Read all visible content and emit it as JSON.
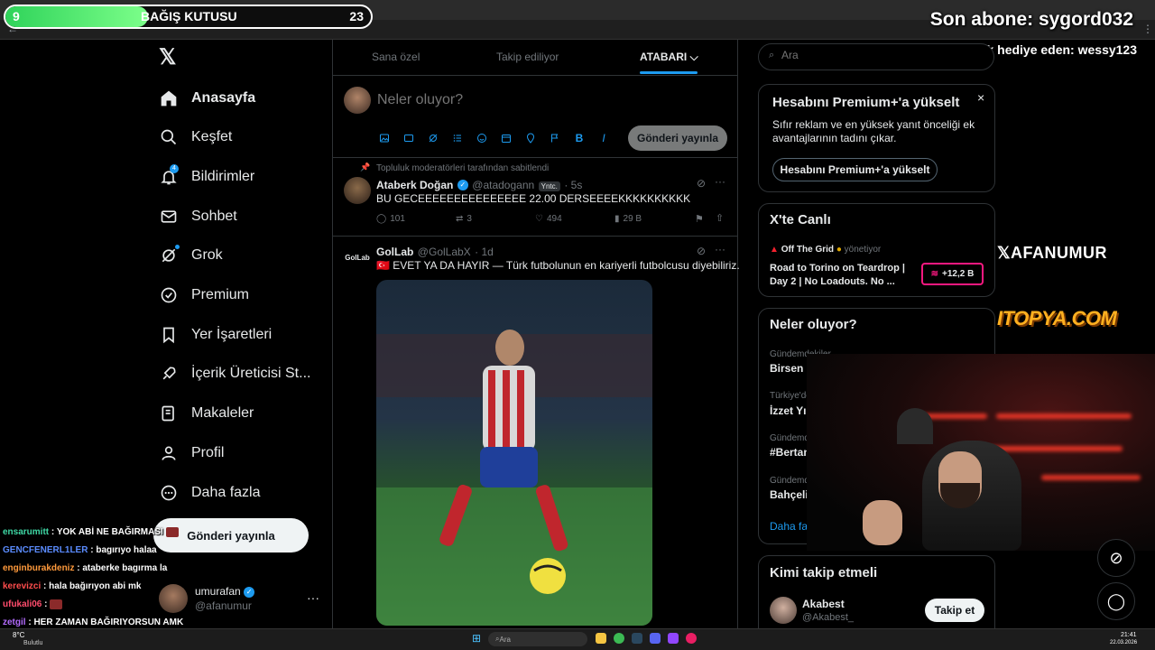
{
  "overlay": {
    "donation": {
      "count": "9",
      "title": "BAĞIŞ KUTUSU",
      "goal": "23",
      "progress": 0.39,
      "color": "#2fd35a"
    },
    "last_subscriber": "Son abone: sygord032",
    "last_gift": "Son abonelik hediye eden: wessy123",
    "sponsor_logo_1": "AFANUMUR",
    "sponsor_logo_2": "ITOPYA.COM"
  },
  "nav": {
    "logo": "𝕏",
    "items": [
      {
        "label": "Anasayfa",
        "icon": "home-icon",
        "active": true
      },
      {
        "label": "Keşfet",
        "icon": "search-icon"
      },
      {
        "label": "Bildirimler",
        "icon": "bell-icon",
        "badge": "4"
      },
      {
        "label": "Sohbet",
        "icon": "mail-icon"
      },
      {
        "label": "Grok",
        "icon": "grok-icon"
      },
      {
        "label": "Premium",
        "icon": "premium-icon"
      },
      {
        "label": "Yer İşaretleri",
        "icon": "bookmark-icon"
      },
      {
        "label": "İçerik Üreticisi St...",
        "icon": "rocket-icon"
      },
      {
        "label": "Makaleler",
        "icon": "article-icon"
      },
      {
        "label": "Profil",
        "icon": "person-icon"
      },
      {
        "label": "Daha fazla",
        "icon": "more-circle-icon"
      }
    ],
    "post_button": "Gönderi yayınla",
    "account": {
      "name": "umurafan",
      "handle": "@afanumur",
      "more": "···"
    }
  },
  "chat": [
    {
      "user": "ensarumitt",
      "msg": ": YOK ABİ NE BAĞIRMASI"
    },
    {
      "user": "GENCFENERL1LER",
      "msg": ": bagırıyo halaa"
    },
    {
      "user": "enginburakdeniz",
      "msg": ": ataberke bagırma la"
    },
    {
      "user": "kerevizci",
      "msg": ": hala bağırıyon abi mk"
    },
    {
      "user": "ufukali06",
      "msg": ":"
    },
    {
      "user": "zetgil",
      "msg": ": HER ZAMAN BAĞIRIYORSUN AMK"
    }
  ],
  "timeline": {
    "tabs": [
      "Sana özel",
      "Takip ediliyor",
      "ATABARI"
    ],
    "compose_placeholder": "Neler oluyor?",
    "compose_post": "Gönderi yayınla",
    "tweets": [
      {
        "pinned": "Topluluk moderatörleri tarafından sabitlendi",
        "name": "Ataberk Doğan",
        "handle": "@atadogann",
        "badge": "Yntc.",
        "time": "· 5s",
        "text": "BU GECEEEEEEEEEEEEEEE 22.00 DERSEEEEKKKKKKKKKK",
        "replies": "101",
        "retweets": "3",
        "likes": "494",
        "views": "29 B"
      },
      {
        "name": "GolLab",
        "handle": "@GolLabX",
        "time": "· 1d",
        "avatar_text": "GolLab",
        "text": "🇹🇷 EVET YA DA HAYIR — Türk futbolunun en kariyerli futbolcusu diyebiliriz."
      }
    ]
  },
  "sidebar": {
    "search_placeholder": "Ara",
    "premium": {
      "title": "Hesabını Premium+'a yükselt",
      "body": "Sıfır reklam ve en yüksek yanıt önceliği ek avantajlarının tadını çıkar.",
      "button": "Hesabını Premium+'a yükselt",
      "close": "×"
    },
    "live": {
      "title": "X'te Canlı",
      "host": "Off The Grid",
      "role": "yönetiyor",
      "stream_title": "Road to Torino on Teardrop | Day 2 | No Loadouts. No ...",
      "viewers": "+12,2 B"
    },
    "trends": {
      "title": "Neler oluyor?",
      "items": [
        {
          "context": "Gündemdekiler",
          "name": "Birsen"
        },
        {
          "context": "Türkiye'de",
          "name": "İzzet Yıl"
        },
        {
          "context": "Gündemde",
          "name": "#Bertan"
        },
        {
          "context": "Gündemde",
          "name": "Bahçeli"
        }
      ],
      "more": "Daha fa"
    },
    "who_to_follow": {
      "title": "Kimi takip etmeli",
      "name": "Akabest",
      "handle": "@Akabest_",
      "button": "Takip et"
    }
  },
  "taskbar": {
    "weather_temp": "8°C",
    "weather_desc": "Bulutlu",
    "search": "Ara",
    "time": "21:41",
    "date": "22.03.2026"
  }
}
